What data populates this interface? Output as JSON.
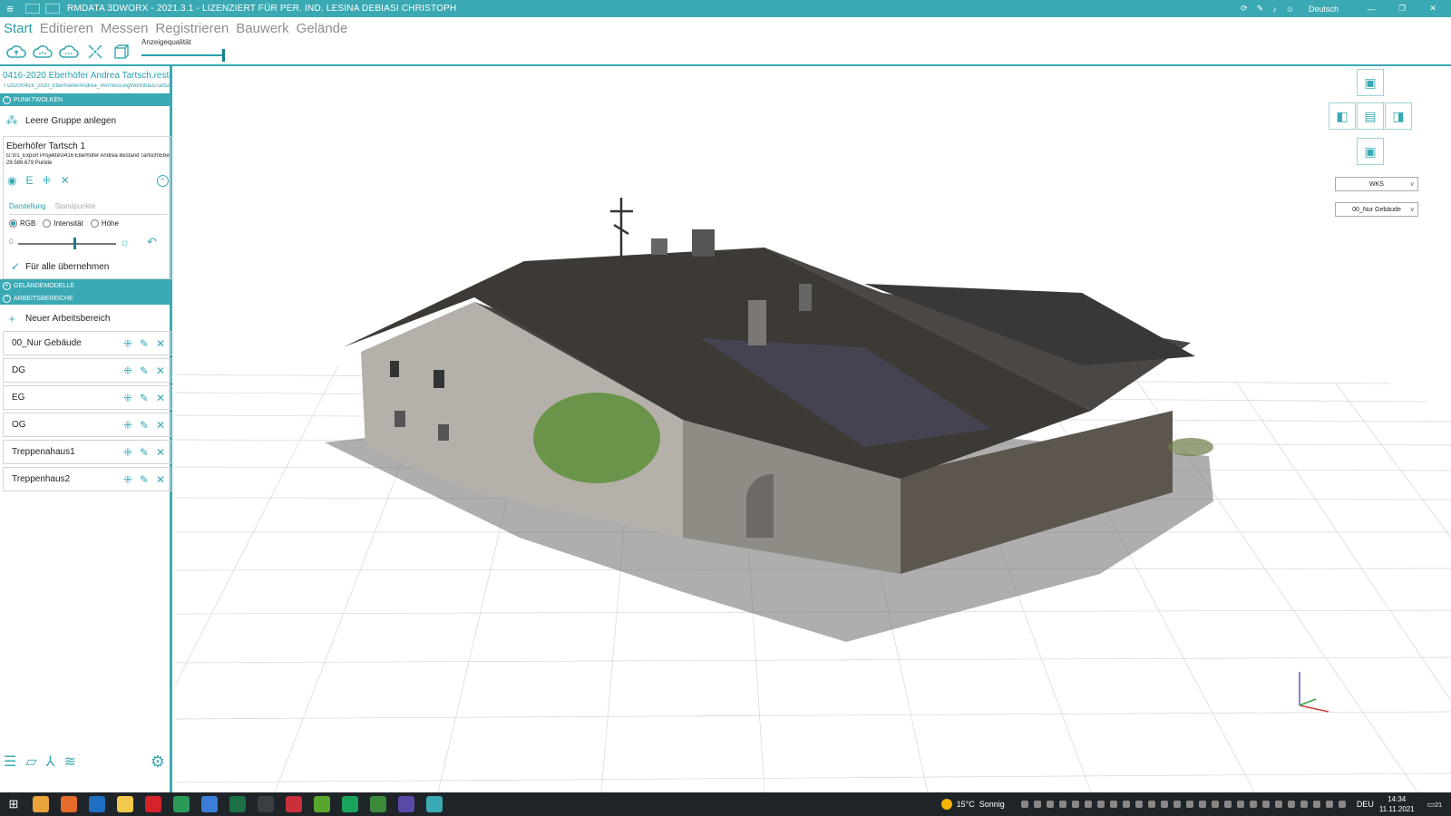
{
  "window": {
    "title": "RMDATA 3DWORX - 2021.3.1 - LIZENZIERT FÜR PER. IND. LESINA DEBIASI CHRISTOPH",
    "language": "Deutsch",
    "accent_color": "#3aa9b3"
  },
  "ribbon": {
    "tabs": [
      {
        "label": "Start",
        "active": true
      },
      {
        "label": "Editieren",
        "active": false
      },
      {
        "label": "Messen",
        "active": false
      },
      {
        "label": "Registrieren",
        "active": false
      },
      {
        "label": "Bauwerk",
        "active": false
      },
      {
        "label": "Gelände",
        "active": false
      }
    ],
    "quality_label": "Anzeigequalität"
  },
  "project": {
    "title": "0416-2020 Eberhöfer Andrea Tartsch.restor",
    "path": "T:\\2020\\0416_2020_EberhoeferAndrea_VermessungWohnhausTartsch"
  },
  "sections": {
    "pointclouds": "PUNKTWOLKEN",
    "terrain": "GELÄNDEMODELLE",
    "workareas": "ARBEITSBEREICHE"
  },
  "pointclouds": {
    "add_group": "Leere Gruppe anlegen",
    "cloud": {
      "name": "Eberhöfer Tartsch 1",
      "path": "G:\\01_Export Projekte\\0416 Eberhöfer Andrea Bestand Tartsch\\Eberhöfer",
      "count": "29.586.679 Punkte",
      "tabs": {
        "display": "Darstellung",
        "stations": "Standpunkte"
      },
      "modes": [
        "RGB",
        "Intensität",
        "Höhe"
      ],
      "selected_mode": "RGB",
      "slider_min": "0",
      "apply_all": "Für alle übernehmen"
    }
  },
  "workareas": {
    "new": "Neuer Arbeitsbereich",
    "items": [
      "00_Nur Gebäude",
      "DG",
      "EG",
      "OG",
      "Treppenahaus1",
      "Treppenhaus2"
    ]
  },
  "viewport": {
    "coord_system": "WKS",
    "active_workarea": "00_Nur Gebäude"
  },
  "taskbar": {
    "temperature": "15°C",
    "weather": "Sonnig",
    "input_lang": "DEU",
    "time": "14:34",
    "date": "11.11.2021",
    "notification_count": "21"
  }
}
